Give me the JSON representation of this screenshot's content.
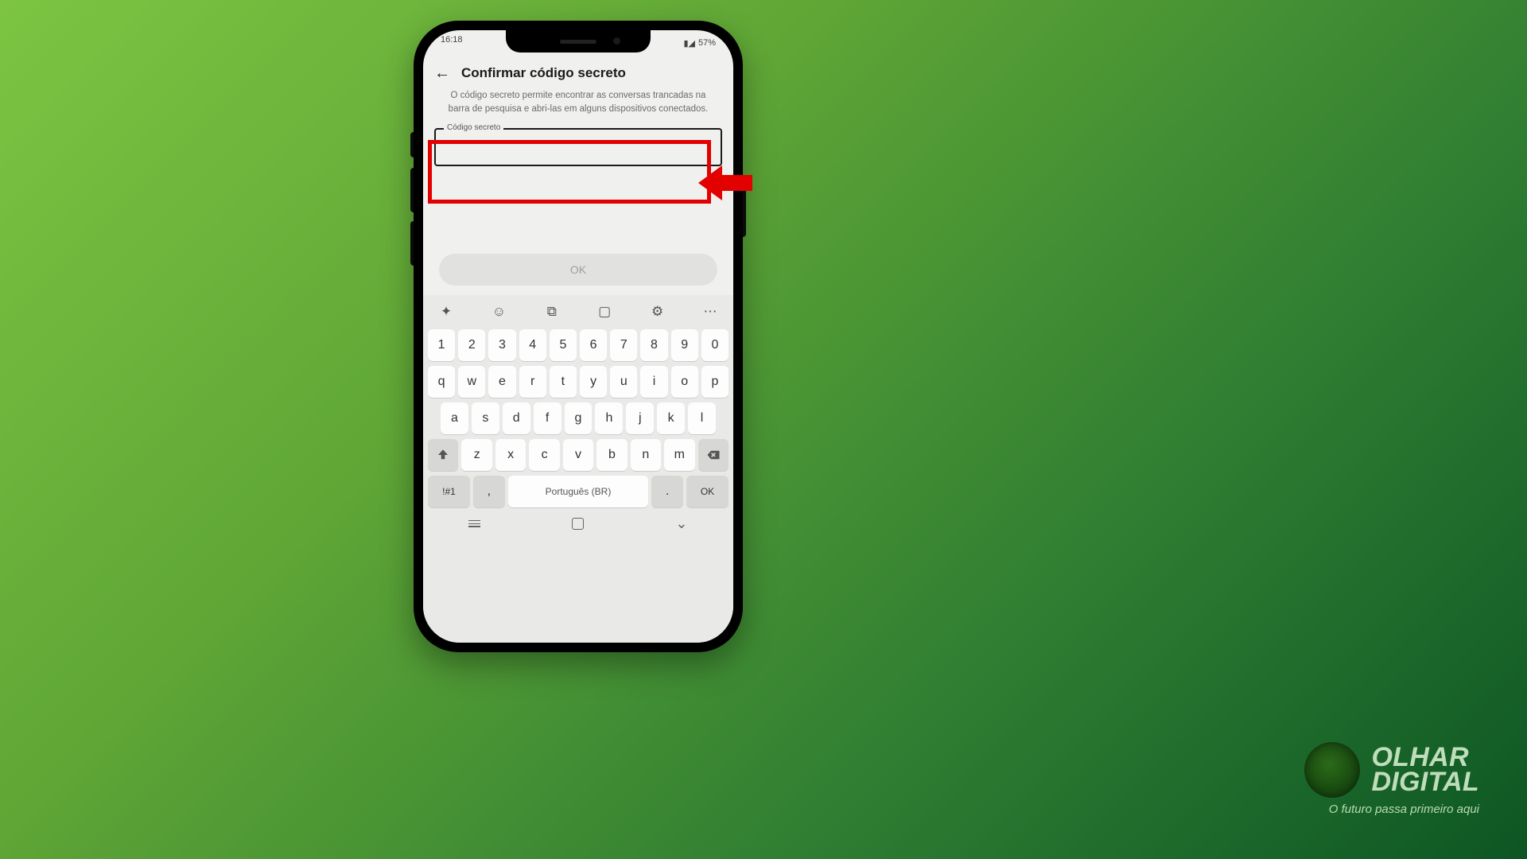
{
  "status": {
    "time": "16:18",
    "battery": "57%",
    "signal_icon": "▮"
  },
  "header": {
    "title": "Confirmar código secreto"
  },
  "description": "O código secreto permite encontrar as conversas trancadas na barra de pesquisa e abri-las em alguns dispositivos conectados.",
  "field": {
    "label": "Código secreto",
    "value": ""
  },
  "ok_button": "OK",
  "keyboard": {
    "tools": [
      "sparkle",
      "emoji",
      "sticker",
      "clipboard",
      "settings",
      "more"
    ],
    "row_num": [
      "1",
      "2",
      "3",
      "4",
      "5",
      "6",
      "7",
      "8",
      "9",
      "0"
    ],
    "row_top": [
      "q",
      "w",
      "e",
      "r",
      "t",
      "y",
      "u",
      "i",
      "o",
      "p"
    ],
    "row_mid": [
      "a",
      "s",
      "d",
      "f",
      "g",
      "h",
      "j",
      "k",
      "l"
    ],
    "row_bot": [
      "z",
      "x",
      "c",
      "v",
      "b",
      "n",
      "m"
    ],
    "num_key": "!#1",
    "comma": ",",
    "space": "Português (BR)",
    "dot": ".",
    "enter": "OK"
  },
  "brand": {
    "line1": "OLHAR",
    "line2": "DIGITAL",
    "tagline": "O futuro passa primeiro aqui"
  }
}
